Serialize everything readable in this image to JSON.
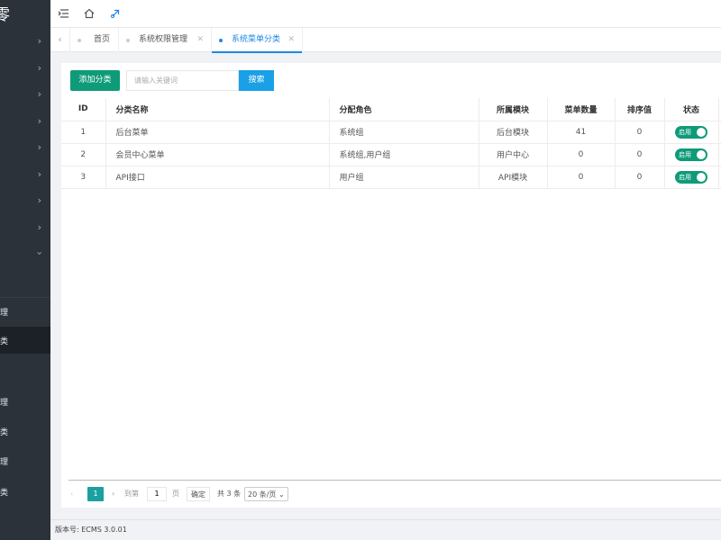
{
  "brand": {
    "logo_char": "零"
  },
  "sidebar": {
    "collapsed_count": 9,
    "active_sub_index": 1,
    "subitems": [
      {
        "label": "理"
      },
      {
        "label": "类"
      },
      {
        "label": "理"
      },
      {
        "label": "类"
      },
      {
        "label": "理"
      },
      {
        "label": "类"
      }
    ]
  },
  "tabs": [
    {
      "label": "首页",
      "closable": false,
      "active": false
    },
    {
      "label": "系统权限管理",
      "closable": true,
      "active": false
    },
    {
      "label": "系统菜单分类",
      "closable": true,
      "active": true
    }
  ],
  "toolbar": {
    "add_label": "添加分类",
    "search_placeholder": "请输入关键词",
    "search_label": "搜索"
  },
  "table": {
    "headers": [
      "ID",
      "分类名称",
      "分配角色",
      "所属模块",
      "菜单数量",
      "排序值",
      "状态"
    ],
    "rows": [
      {
        "id": "1",
        "name": "后台菜单",
        "roles": "系统组",
        "module": "后台模块",
        "count": "41",
        "sort": "0",
        "status": "启用"
      },
      {
        "id": "2",
        "name": "会员中心菜单",
        "roles": "系统组,用户组",
        "module": "用户中心",
        "count": "0",
        "sort": "0",
        "status": "启用"
      },
      {
        "id": "3",
        "name": "API接口",
        "roles": "用户组",
        "module": "API模块",
        "count": "0",
        "sort": "0",
        "status": "启用"
      }
    ]
  },
  "pagination": {
    "current_page": "1",
    "goto_prefix": "到第",
    "goto_value": "1",
    "goto_suffix": "页",
    "confirm_label": "确定",
    "total_text": "共 3 条",
    "page_size_text": "20 条/页"
  },
  "footer": {
    "version_text": "版本号: ECMS 3.0.01"
  },
  "colors": {
    "sidebar_bg": "#2b323a",
    "primary_green": "#0e9b78",
    "primary_blue": "#1aa0e6",
    "tab_active": "#1e88e5"
  }
}
